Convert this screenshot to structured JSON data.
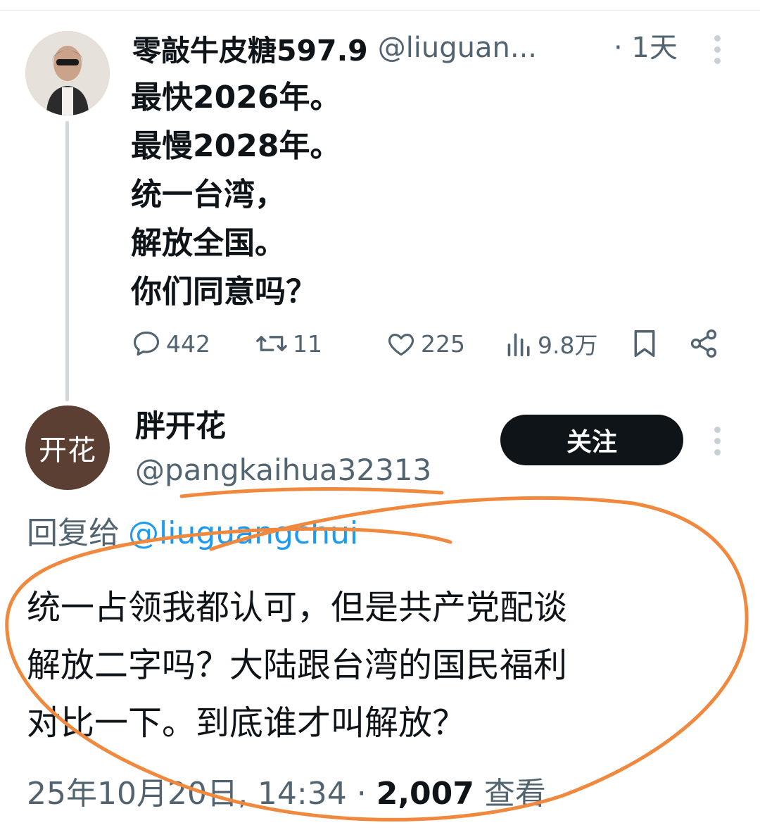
{
  "parent_tweet": {
    "display_name": "零敲牛皮糖597.9",
    "handle": "@liuguan...",
    "time": "· 1天",
    "lines": [
      "最快2026年。",
      "最慢2028年。",
      "统一台湾，",
      "解放全国。",
      "你们同意吗？"
    ],
    "stats": {
      "replies": "442",
      "retweets": "11",
      "likes": "225",
      "views": "9.8万"
    }
  },
  "reply_tweet": {
    "avatar_text": "开花",
    "display_name": "胖开花",
    "handle": "@pangkaihua32313",
    "follow_label": "关注",
    "reply_to_label": "回复给",
    "reply_to_handle": "@liuguangchui",
    "lines": [
      "统一占领我都认可，但是共产党配谈",
      "解放二字吗？大陆跟台湾的国民福利",
      "对比一下。到底谁才叫解放？"
    ],
    "datetime": "25年10月20日, 14:34 · ",
    "views_count": "2,007",
    "views_label": " 查看"
  },
  "colors": {
    "text_primary": "#0f1419",
    "text_secondary": "#536471",
    "link": "#1d9bf0",
    "annotation_orange": "#f0883e",
    "follow_button_bg": "#0f1419"
  },
  "icons": [
    "reply-icon",
    "retweet-icon",
    "like-icon",
    "views-icon",
    "bookmark-icon",
    "share-icon",
    "more-icon"
  ]
}
